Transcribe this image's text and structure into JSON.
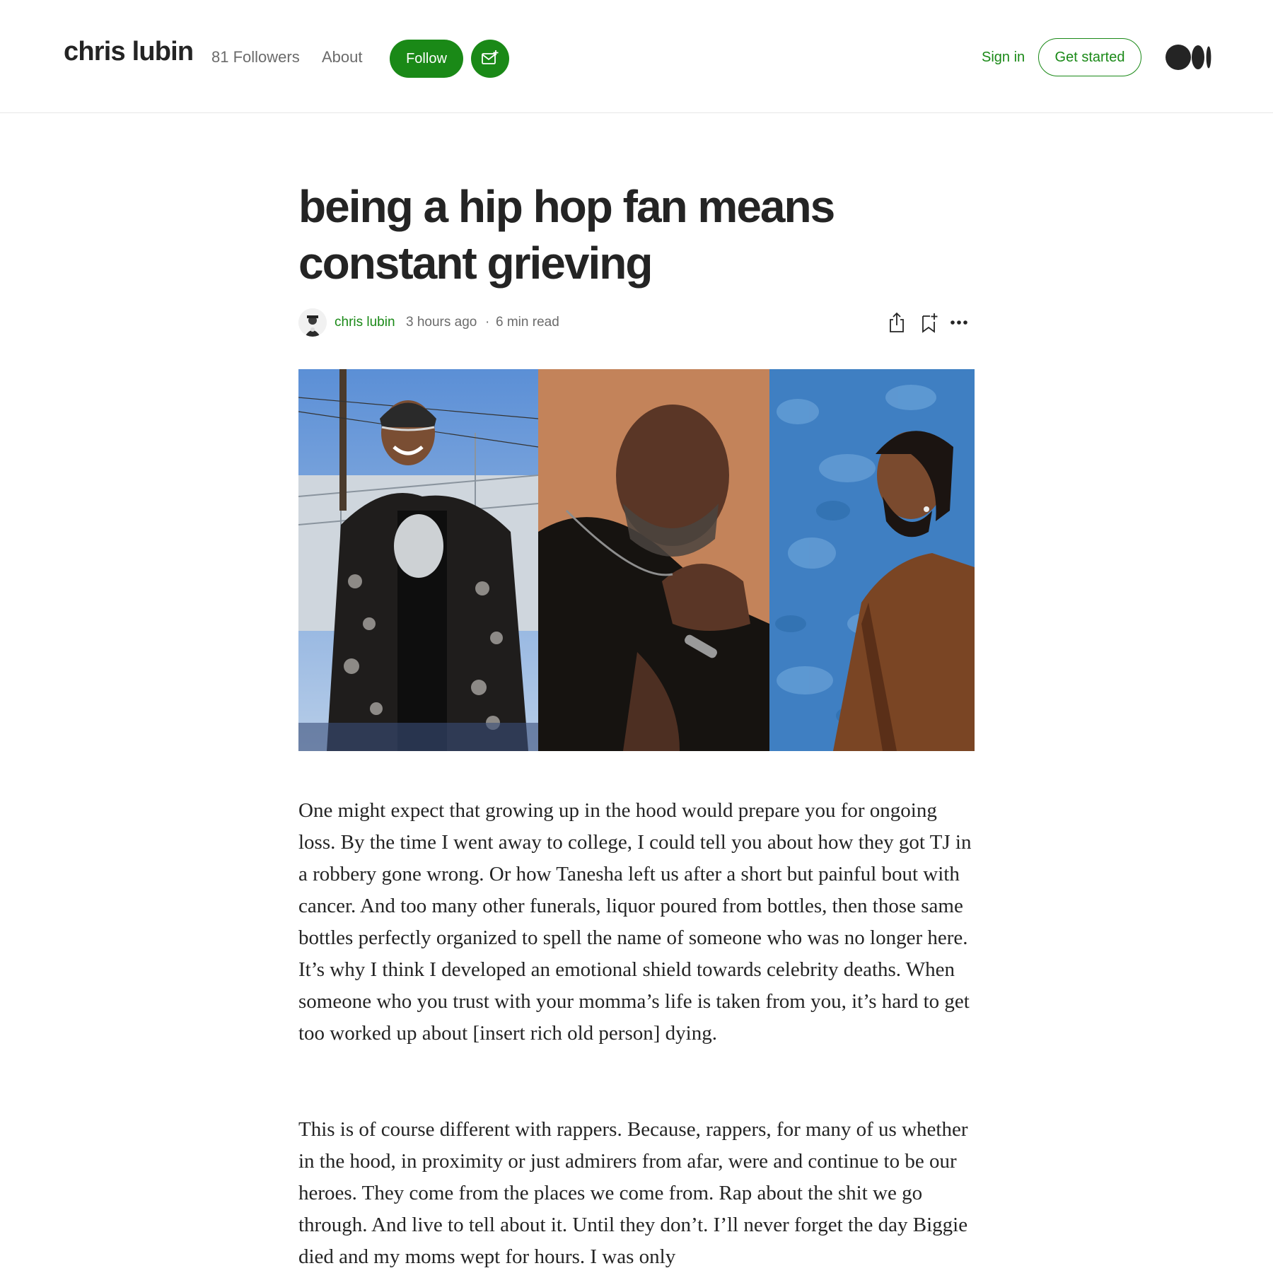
{
  "header": {
    "blog_name": "chris lubin",
    "followers": "81 Followers",
    "about": "About",
    "follow": "Follow",
    "sign_in": "Sign in",
    "get_started": "Get started",
    "accent_color": "#1a8917"
  },
  "article": {
    "title": "being a hip hop fan means constant grieving",
    "author": "chris lubin",
    "time_ago": "3 hours ago",
    "separator": "·",
    "read_time": "6 min read",
    "paragraphs": [
      "One might expect that growing up in the hood would prepare you for ongoing loss. By the time I went away to college, I could tell you about how they got TJ in a robbery gone wrong. Or how Tanesha left us after a short but painful bout with cancer. And too many other funerals, liquor poured from bottles, then those same bottles perfectly organized to spell the name of someone who was no longer here. It’s why I think I developed an emotional shield towards celebrity deaths. When someone who you trust with your momma’s life is taken from you, it’s hard to get too worked up about [insert rich old person] dying.",
      "This is of course different with rappers. Because, rappers, for many of us whether in the hood, in proximity or just admirers from afar, were and continue to be our heroes. They come from the places we come from. Rap about the shit we go through. And live to tell about it. Until they don’t. I’ll never forget the day Biggie died and my moms wept for hours. I was only"
    ]
  },
  "icons": {
    "subscribe": "mail-plus-icon",
    "share": "share-icon",
    "bookmark": "bookmark-add-icon",
    "more": "more-dots-icon",
    "logo": "medium-logo-icon"
  }
}
